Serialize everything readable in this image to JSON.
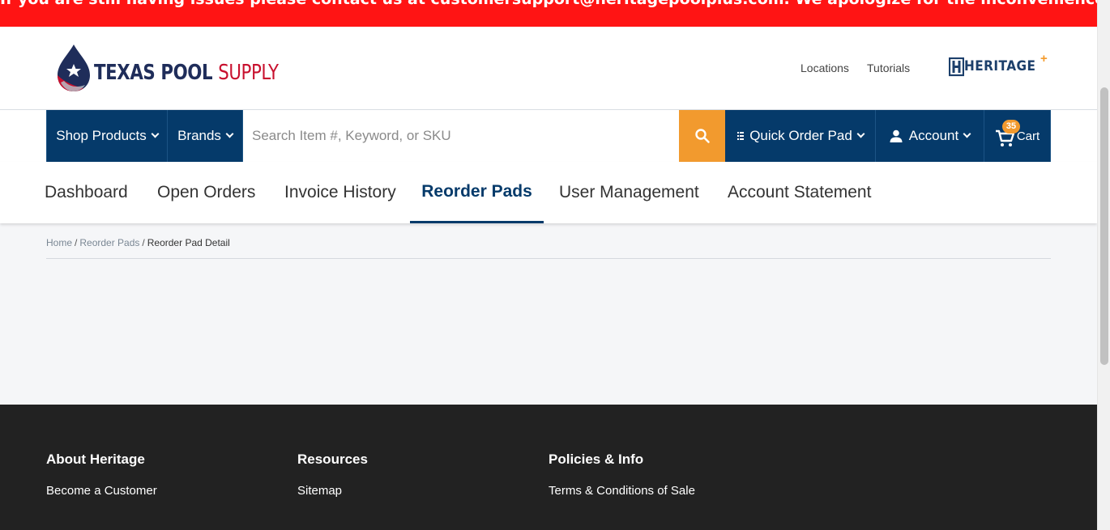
{
  "alert": {
    "text": "If you are still having issues please contact us at customersupport@heritagepoolplus.com. We apologize for the inconvenience."
  },
  "brand": {
    "logo_word1": "TEXAS POOL",
    "logo_word2": "SUPPLY",
    "partner_logo": "HERITAGE",
    "partner_plus": "+"
  },
  "top_links": {
    "locations": "Locations",
    "tutorials": "Tutorials"
  },
  "nav": {
    "shop_products": "Shop Products",
    "brands": "Brands",
    "search_placeholder": "Search Item #, Keyword, or SKU",
    "quick_order_pad": "Quick Order Pad",
    "account": "Account",
    "cart": "Cart",
    "cart_count": "35"
  },
  "tabs": [
    {
      "label": "Dashboard"
    },
    {
      "label": "Open Orders"
    },
    {
      "label": "Invoice History"
    },
    {
      "label": "Reorder Pads",
      "active": true
    },
    {
      "label": "User Management"
    },
    {
      "label": "Account Statement"
    }
  ],
  "breadcrumb": {
    "home": "Home",
    "reorder_pads": "Reorder Pads",
    "current": "Reorder Pad Detail",
    "separator": "/"
  },
  "footer": {
    "columns": [
      {
        "heading": "About Heritage",
        "link": "Become a Customer"
      },
      {
        "heading": "Resources",
        "link": "Sitemap"
      },
      {
        "heading": "Policies & Info",
        "link": "Terms & Conditions of Sale"
      }
    ]
  },
  "colors": {
    "alert": "#ff1414",
    "nav_background": "#053a6a",
    "accent_orange": "#f29a2e",
    "brand_red": "#c8102e",
    "footer_background": "#222222"
  }
}
